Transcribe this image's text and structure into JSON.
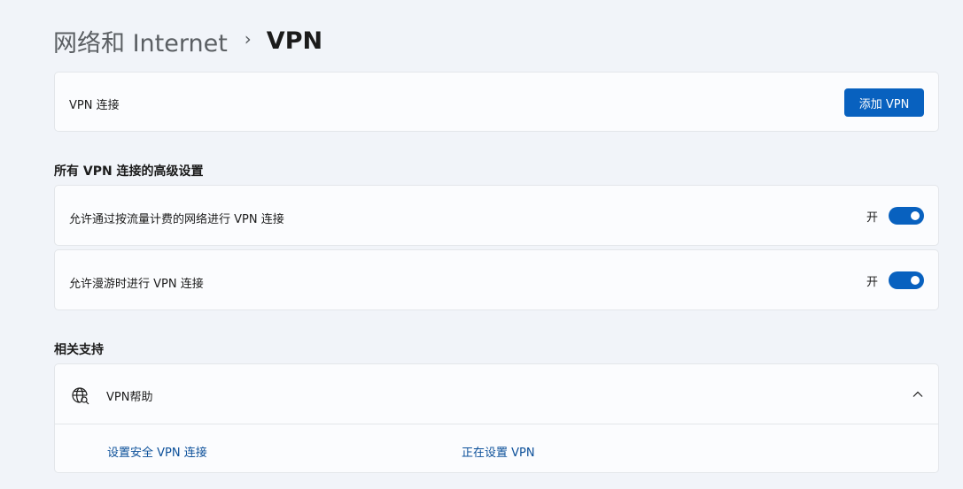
{
  "breadcrumb": {
    "parent": "网络和 Internet",
    "separator": "›",
    "current": "VPN"
  },
  "vpn_connections": {
    "label": "VPN 连接",
    "add_button": "添加 VPN"
  },
  "advanced": {
    "title": "所有 VPN 连接的高级设置",
    "metered": {
      "label": "允许通过按流量计费的网络进行 VPN 连接",
      "state": "开",
      "on": true
    },
    "roaming": {
      "label": "允许漫游时进行 VPN 连接",
      "state": "开",
      "on": true
    }
  },
  "related": {
    "title": "相关支持",
    "help": {
      "icon": "globe-search-icon",
      "label": "VPN帮助",
      "expanded": true,
      "links": [
        "设置安全 VPN 连接",
        "正在设置 VPN"
      ]
    }
  },
  "colors": {
    "accent": "#0861bf",
    "link": "#0b4f99",
    "background": "#f1f4f9",
    "card": "#fbfcfe"
  }
}
